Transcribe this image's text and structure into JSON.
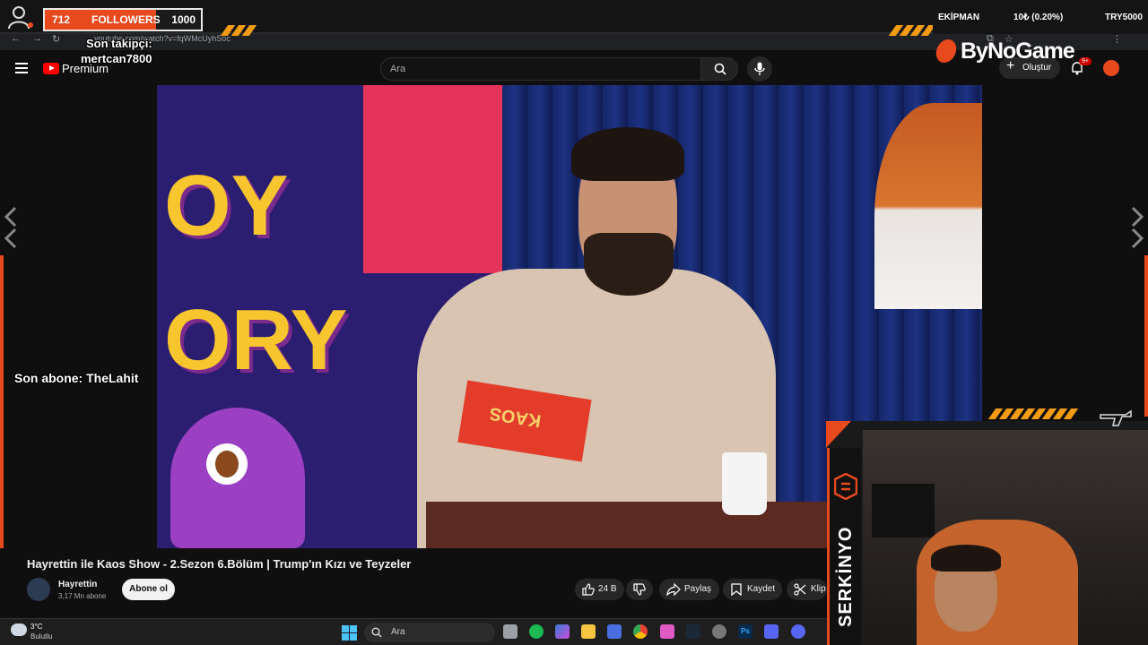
{
  "overlay": {
    "followers_count": "712",
    "followers_label": "FOLLOWERS",
    "followers_goal": "1000",
    "followers_progress": 0.712,
    "last_follower_label": "Son takipçi:",
    "last_follower_name": "mertcan7800",
    "last_subscriber": "Son abone: TheLahit",
    "ticker_label": "EKİPMAN",
    "ticker_value": "10₺ (0.20%)",
    "ticker_code": "TRY5000",
    "sponsor": "ByNoGame",
    "streamer_name": "SERKİNYO",
    "accent_color": "#e8491d",
    "stripe_color": "#f39c12"
  },
  "browser": {
    "url": "youtube.com/watch?v=fqWMcUyhSoc"
  },
  "youtube": {
    "logo_label": "Premium",
    "search_placeholder": "Ara",
    "create_label": "Oluştur",
    "notification_badge": "9+"
  },
  "video": {
    "poster_text": "OY\nORY",
    "card_text": "KAOS",
    "title": "Hayrettin ile Kaos Show - 2.Sezon 6.Bölüm | Trump'ın Kızı ve Teyzeler",
    "channel_name": "Hayrettin",
    "subscribers": "3,17 Mn abone",
    "subscribe_label": "Abone ol",
    "likes": "24 B",
    "share_label": "Paylaş",
    "save_label": "Kaydet",
    "clip_label": "Klip"
  },
  "taskbar": {
    "weather_temp": "3°C",
    "weather_desc": "Bulutlu",
    "search_placeholder": "Ara",
    "apps": [
      "file-explorer",
      "spotify",
      "copilot",
      "folder",
      "store",
      "chrome",
      "paint",
      "steam",
      "settings",
      "photoshop",
      "discord"
    ]
  }
}
